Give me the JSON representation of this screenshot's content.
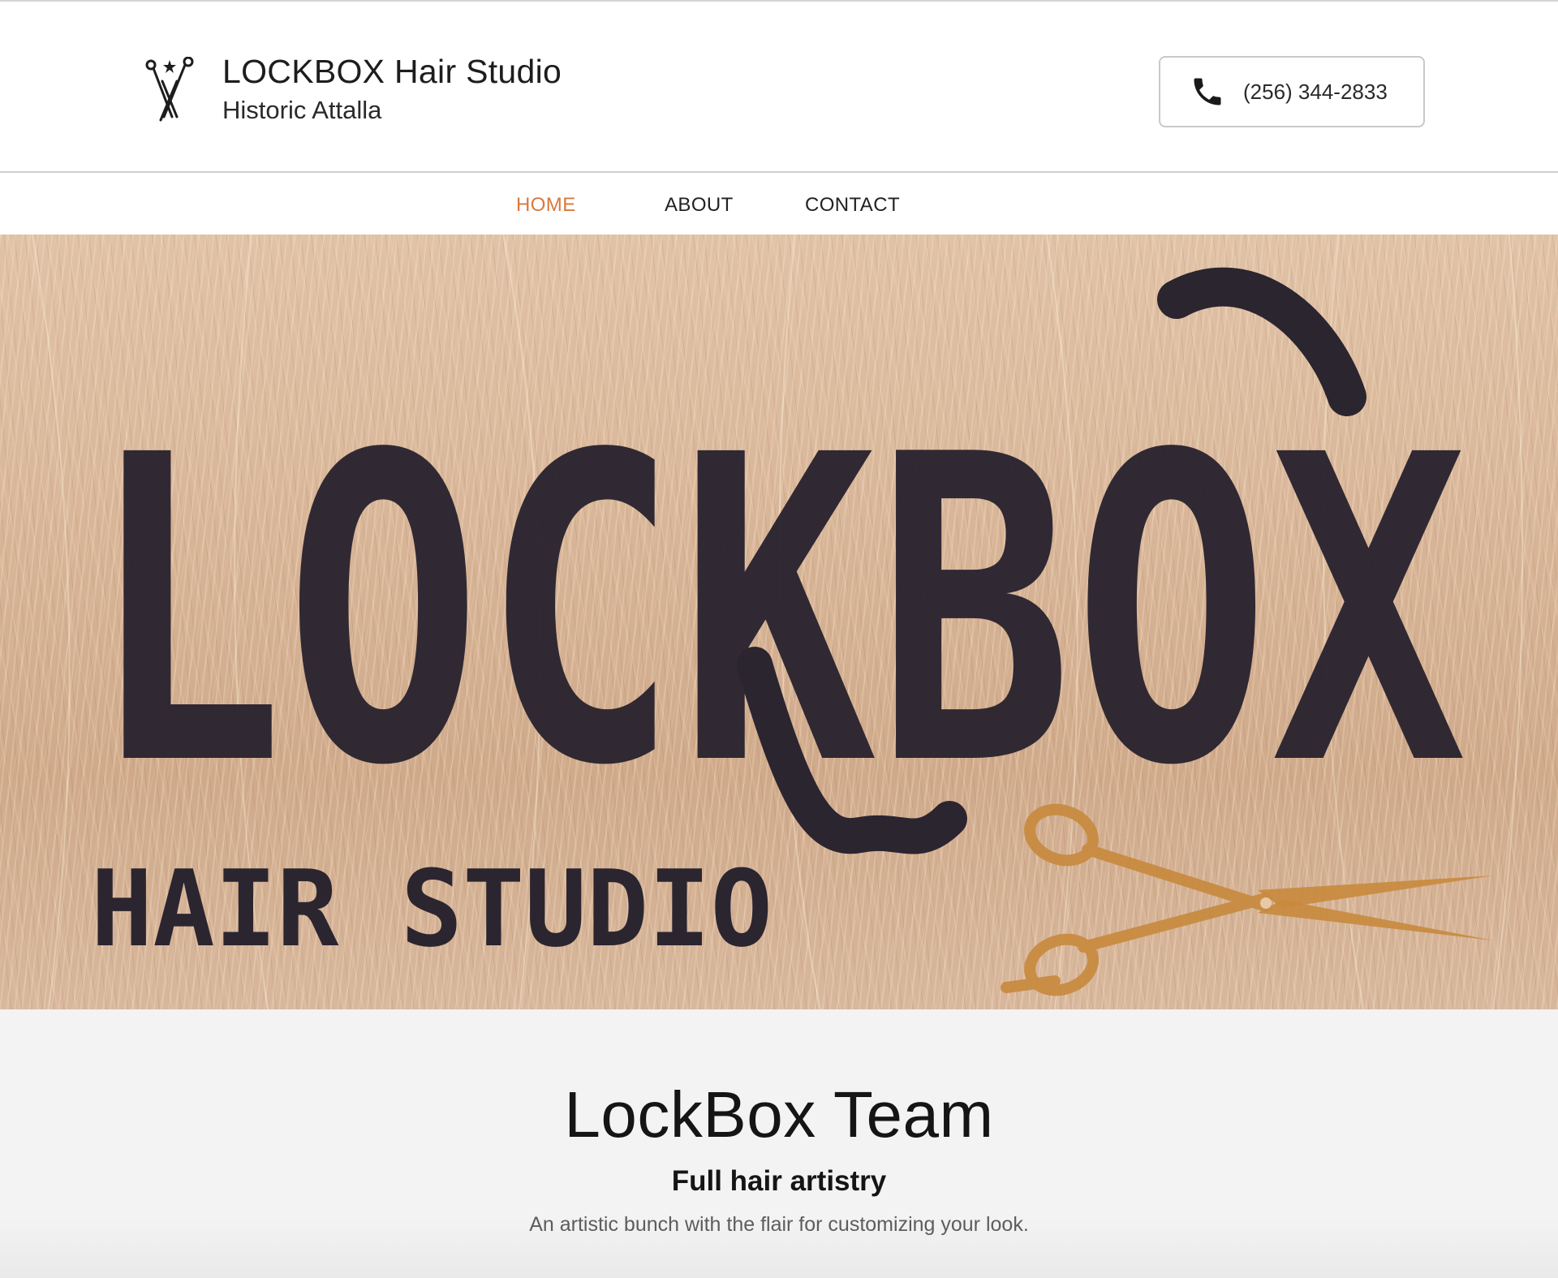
{
  "header": {
    "brand_name": "LOCKBOX Hair Studio",
    "tagline": "Historic Attalla",
    "logo_icon": "scissors-logo-icon",
    "phone": {
      "icon": "phone-icon",
      "number": "(256) 344-2833"
    }
  },
  "nav": {
    "items": [
      {
        "label": "HOME",
        "active": true
      },
      {
        "label": "ABOUT",
        "active": false
      },
      {
        "label": "CONTACT",
        "active": false
      }
    ],
    "active_color": "#d9783d"
  },
  "hero": {
    "logo_word": "LOCKBOX",
    "logo_subtitle": "HAIR STUDIO",
    "logo_color": "#2b2530",
    "scissors_color": "#c88a3e"
  },
  "team": {
    "title": "LockBox Team",
    "subtitle": "Full hair artistry",
    "description": "An artistic bunch with the flair for customizing your look."
  }
}
